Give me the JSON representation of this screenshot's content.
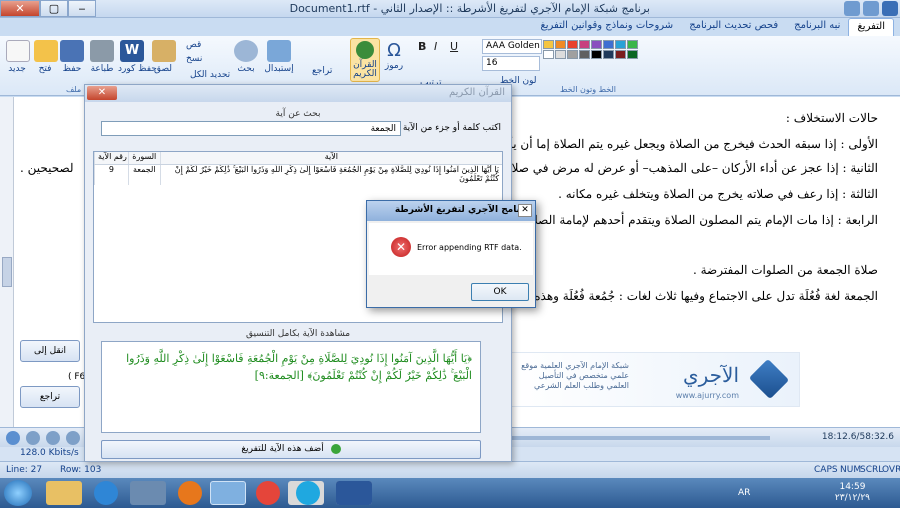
{
  "window": {
    "title": "برنامج شبكة الإمام الآجري لتفريغ الأشرطة :: الإصدار الثاني - Document1.rtf",
    "minimize_label": "‒",
    "maximize_label": "▢",
    "close_label": "✕"
  },
  "tabs": [
    "التفريغ",
    "نبه البرنامج",
    "فحص تحديث البرنامج",
    "شروحات ونماذج وقوانين التفريغ"
  ],
  "ribbon": {
    "clipboard": [
      "جديد",
      "فتح",
      "حفظ",
      "طباعة",
      "حفظ كورد"
    ],
    "clipboard_group": "ملف",
    "edit": [
      "لصق",
      "قص",
      "نسخ",
      "تحديد الكل"
    ],
    "find": "بحث",
    "replace": "إستبدال",
    "undo": "تراجع",
    "quran": "القرآن الكريم",
    "symbols": "رموز",
    "format_group": "الخط وتون الخط",
    "font_name": "AAA Golden",
    "font_size": "16",
    "arrange": "ترتيب",
    "font_color_label": "لون الخط",
    "bold": "B",
    "italic": "I",
    "underline": "U"
  },
  "colors": {
    "swatches": [
      "#f4c542",
      "#f08a24",
      "#e8432e",
      "#c7417e",
      "#8a4fbf",
      "#3f6fd1",
      "#2aa1d6",
      "#3bb54a",
      "#ffffff",
      "#dcdcdc",
      "#a0a0a0",
      "#606060",
      "#000000",
      "#1e395b",
      "#7a1e1e",
      "#0b6623"
    ]
  },
  "document": {
    "lines": [
      "حالات الاستخلاف :",
      "الأولى : إذا سبقه الحدث فيخرج من الصلاة ويجعل غيره يتم الصلاة إما أن يأخذ بيده ويقدمه إل",
      "الثانية : إذا عجز عن أداء الأركان –على المذهب– أو عرض له مرض في صلاته فيتأخر ويقدم غ",
      "الثالثة : إذا رعف في صلاته يخرج من الصلاة ويتخلف غيره مكانه .",
      "الرابعة : إذا مات الإمام يتم المصلون الصلاة ويتقدم أحدهم لإمامة الصلاة .",
      "صلاة الجمعة من الصلوات المفترضة .",
      "الجمعة لغة فُعُلَة تدل على الاجتماع وفيها ثلاث لغات : جُمُعة فُعُلَة وهذه أشهر اللغات وبها"
    ],
    "right_fragment": "لصحيحين ."
  },
  "side": {
    "move_btn": "انقل إلى",
    "back_btn": "تراجع",
    "shortcut": "( F6"
  },
  "banner": {
    "brand": "الآجري",
    "site": "www.ajurry.com",
    "desc": "شبكة الإمام الآجري العلمية موقع علمي متخصص في التأصيل العلمي وطلب العلم الشرعي"
  },
  "dialog": {
    "title": "القرآن الكريم",
    "close_label": "✕",
    "search_section": "بحث عن آية",
    "search_label": "اكتب كلمة أو جزء من الآية",
    "search_value": "الجمعة",
    "columns": {
      "num": "رقم الآية",
      "sura": "السورة",
      "aya": "الآية"
    },
    "rows": [
      {
        "num": "9",
        "sura": "الجمعة",
        "aya": "يَا أَيُّهَا الَّذِينَ آمَنُوا إِذَا نُودِيَ لِلصَّلَاةِ مِنْ يَوْمِ الْجُمُعَةِ فَاسْعَوْا إِلَىٰ ذِكْرِ اللَّهِ وَذَرُوا الْبَيْعَ ۚ ذَٰلِكُمْ خَيْرٌ لَكُمْ إِنْ كُنْتُمْ تَعْلَمُونَ"
      }
    ],
    "preview_section": "مشاهدة الآية بكامل التنسيق",
    "preview_text": "﴿يَا أَيُّهَا الَّذِينَ آمَنُوا إِذَا نُودِيَ لِلصَّلَاةِ مِنْ يَوْمِ الْجُمُعَةِ فَاسْعَوْا إِلَىٰ ذِكْرِ اللَّهِ وَذَرُوا الْبَيْعَ ۚ ذَٰلِكُمْ خَيْرٌ لَكُمْ إِنْ كُنْتُمْ تَعْلَمُونَ﴾ [الجمعة:٩]",
    "add_button": "أضف هذه الآية للتفريغ"
  },
  "message_box": {
    "title": "برنامج الآجري لتفريغ الأشرطة",
    "close_label": "✕",
    "message": "Error appending RTF data.",
    "icon_symbol": "✕",
    "ok_label": "OK"
  },
  "media": {
    "bitrate": "128.0 Kbits/s",
    "time": "18:12.6/58:32.6"
  },
  "status": {
    "line": "Line: 27",
    "row": "Row: 103",
    "keys": [
      "CAPS",
      "NUM",
      "SCRL",
      "OVR"
    ]
  },
  "taskbar": {
    "lang": "AR",
    "time": "14:59",
    "date": "٢٣/١٢/٢٩"
  }
}
